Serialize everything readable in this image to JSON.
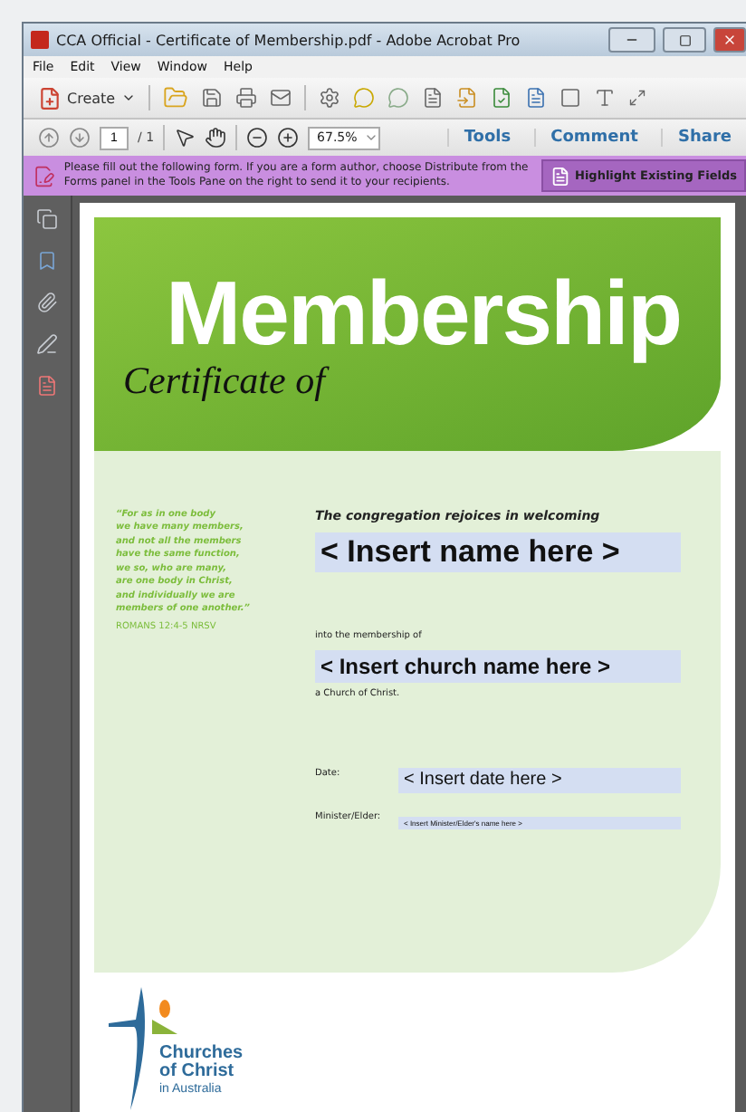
{
  "window": {
    "title": "CCA Official - Certificate of Membership.pdf - Adobe Acrobat Pro"
  },
  "menu": [
    "File",
    "Edit",
    "View",
    "Window",
    "Help"
  ],
  "toolbar": {
    "create": "Create"
  },
  "navigation": {
    "page": "1",
    "page_count": "/ 1",
    "zoom": "67.5%",
    "panels": [
      "Tools",
      "Comment",
      "Share"
    ]
  },
  "form_bar": {
    "message": "Please fill out the following form. If you are a form author, choose Distribute from the Forms panel in the Tools Pane on the right to send it to your recipients.",
    "button": "Highlight Existing Fields"
  },
  "certificate": {
    "heading": "Membership",
    "subheading": "Certificate of",
    "quote": [
      "“For as in one body",
      "we have many members,",
      "and not all the members",
      "have the same function,",
      "we so, who are many,",
      "are one body in Christ,",
      "and individually we are",
      "members of one another.”"
    ],
    "quote_source": "ROMANS 12:4-5 NRSV",
    "welcome": "The congregation rejoices in welcoming",
    "name_field": {
      "value": "< Insert name here >"
    },
    "membership_label": "into the membership of",
    "church_field": {
      "value": "< Insert church name here >"
    },
    "church_suffix": "a Church of Christ.",
    "date_label": "Date:",
    "date_field": {
      "value": "< Insert date here >"
    },
    "minister_label": "Minister/Elder:",
    "minister_field": {
      "value": "< Insert Minister/Elder's name here >"
    }
  },
  "logo": {
    "lines": [
      "Churches",
      "of Christ",
      "in Australia"
    ]
  }
}
